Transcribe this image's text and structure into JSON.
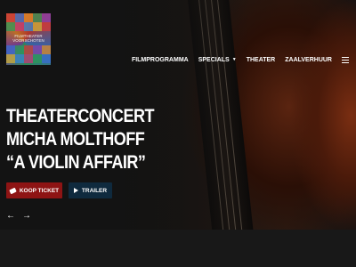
{
  "logo": {
    "text": "FILMTHEATER VOORSCHOTEN"
  },
  "nav": {
    "items": [
      {
        "label": "FILMPROGRAMMA"
      },
      {
        "label": "SPECIALS",
        "has_dropdown": true
      },
      {
        "label": "THEATER"
      },
      {
        "label": "ZAALVERHUUR"
      }
    ],
    "menu_icon": "hamburger-icon"
  },
  "hero": {
    "lines": [
      "THEATERCONCERT",
      "MICHA MOLTHOFF",
      "“A VIOLIN AFFAIR”"
    ],
    "buttons": {
      "ticket_label": "KOOP TICKET",
      "trailer_label": "TRAILER"
    },
    "arrows": {
      "prev": "←",
      "next": "→"
    }
  },
  "colors": {
    "ticket_button": "#8e1414",
    "trailer_button": "#0f2a3e",
    "background": "#171717"
  }
}
